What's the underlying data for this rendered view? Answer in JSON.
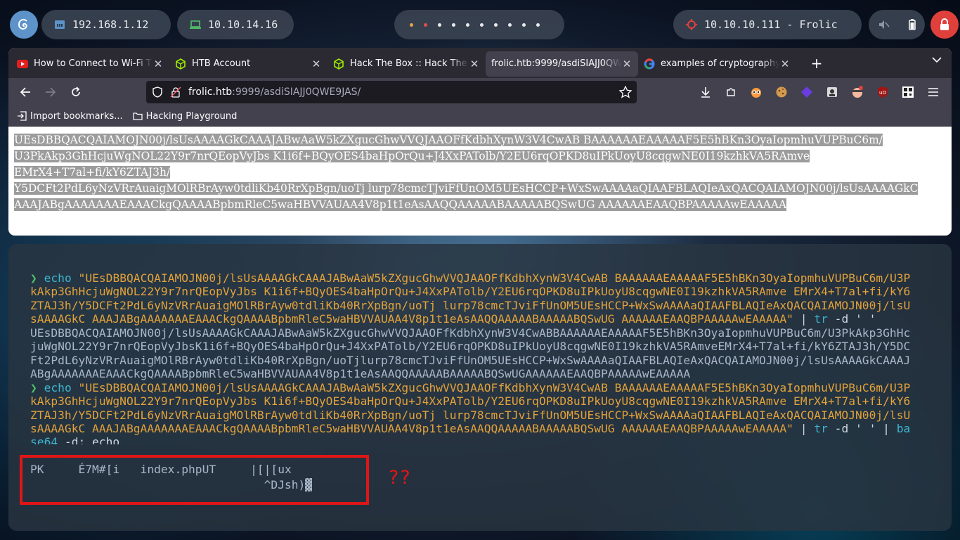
{
  "panel": {
    "local_ip": "192.168.1.12",
    "vpn_ip": "10.10.14.16",
    "target_label": "10.10.10.111 - Frolic",
    "workspace_count": 11,
    "active_workspace": 0
  },
  "browser": {
    "tabs": [
      {
        "title": "How to Connect to Wi-Fi Th",
        "favicon": "youtube-icon",
        "active": false
      },
      {
        "title": "HTB Account",
        "favicon": "htb-cube-icon",
        "active": false
      },
      {
        "title": "Hack The Box :: Hack The B",
        "favicon": "htb-cube-icon",
        "active": false
      },
      {
        "title": "frolic.htb:9999/asdiSIAJJ0QWE",
        "favicon": "none",
        "active": true
      },
      {
        "title": "examples of cryptography",
        "favicon": "google-icon",
        "active": false
      }
    ],
    "url_host": "frolic.htb",
    "url_rest": ":9999/asdiSIAJJ0QWE9JAS/",
    "bookmarks": [
      {
        "label": "Import bookmarks...",
        "icon": "import-icon"
      },
      {
        "label": "Hacking Playground",
        "icon": "folder-icon"
      }
    ],
    "page_lines": [
      "UEsDBBQACQAIAMOJN00j/lsUsAAAAGkCAAAJABwAaW5kZXgucGhwVVQJAAOFfKdbhXynW3V4CwAB BAAAAAAEAAAAAF5E5hBKn3OyaIopmhuVUPBuC6m/",
      "U3PkAkp3GhHcjuWgNOL22Y9r7nrQEopVyJbs K1i6f+BQyOES4baHpOrQu+J4XxPATolb/Y2EU6rqOPKD8uIPkUoyU8cqgwNE0I19kzhkVA5RAmve EMrX4+T7al+fi/kY6ZTAJ3h/",
      "Y5DCFt2PdL6yNzVRrAuaigMOlRBrAyw0tdliKb40RrXpBgn/uoTj lurp78cmcTJviFfUnOM5UEsHCCP+WxSwAAAAaQIAAFBLAQIeAxQACQAIAMOJN00j/lsUsAAAAGkC",
      "AAAJABgAAAAAAAEAAACkgQAAAABpbmRleC5waHBVVAUAA4V8p1t1eAsAAQQAAAAABAAAAABQSwUG AAAAAAEAAQBPAAAAAwEAAAAA"
    ]
  },
  "terminal": {
    "prompt": "❯",
    "command1": {
      "cmd": "echo",
      "lines": [
        "\"UEsDBBQACQAIAMOJN00j/lsUsAAAAGkCAAAJABwAaW5kZXgucGhwVVQJAAOFfKdbhXynW3V4CwAB BAAAAAAEAAAAAF5E5hBKn3OyaIopmhuVUPBuC6m/U3P",
        "kAkp3GhHcjuWgNOL22Y9r7nrQEopVyJbs K1i6f+BQyOES4baHpOrQu+J4XxPATolb/Y2EU6rqOPKD8uIPkUoyU8cqgwNE0I19kzhkVA5RAmve EMrX4+T7al+fi/kY6",
        "ZTAJ3h/Y5DCFt2PdL6yNzVRrAuaigMOlRBrAyw0tdliKb40RrXpBgn/uoTj lurp78cmcTJviFfUnOM5UEsHCCP+WxSwAAAAaQIAAFBLAQIeAxQACQAIAMOJN00j/lsU",
        "sAAAAGkC AAAJABgAAAAAAAEAAACkgQAAAABpbmRleC5waHBVVAUAA4V8p1t1eAsAAQQAAAAABAAAAABQSwUG AAAAAAEAAQBPAAAAAwEAAAAA\""
      ],
      "pipe": " | ",
      "tr_cmd": "tr",
      "tr_args": " -d ' '"
    },
    "output1": [
      "UEsDBBQACQAIAMOJN00j/lsUsAAAAGkCAAAJABwAaW5kZXgucGhwVVQJAAOFfKdbhXynW3V4CwABBAAAAAAEAAAAAF5E5hBKn3OyaIopmhuVUPBuC6m/U3PkAkp3GhHc",
      "juWgNOL22Y9r7nrQEopVyJbsK1i6f+BQyOES4baHpOrQu+J4XxPATolb/Y2EU6rqOPKD8uIPkUoyU8cqgwNE0I19kzhkVA5RAmveEMrX4+T7al+fi/kY6ZTAJ3h/Y5DC",
      "Ft2PdL6yNzVRrAuaigMOlRBrAyw0tdliKb40RrXpBgn/uoTjlurp78cmcTJviFfUnOM5UEsHCCP+WxSwAAAAaQIAAFBLAQIeAxQACQAIAMOJN00j/lsUsAAAAGkCAAAJ",
      "ABgAAAAAAAEAAACkgQAAAABpbmRleC5waHBVVAUAA4V8p1t1eAsAAQQAAAAABAAAAABQSwUGAAAAAAEAAQBPAAAAAwEAAAAA"
    ],
    "command2": {
      "cmd": "echo",
      "lines": [
        "\"UEsDBBQACQAIAMOJN00j/lsUsAAAAGkCAAAJABwAaW5kZXgucGhwVVQJAAOFfKdbhXynW3V4CwAB BAAAAAAEAAAAAF5E5hBKn3OyaIopmhuVUPBuC6m/U3P",
        "kAkp3GhHcjuWgNOL22Y9r7nrQEopVyJbs K1i6f+BQyOES4baHpOrQu+J4XxPATolb/Y2EU6rqOPKD8uIPkUoyU8cqgwNE0I19kzhkVA5RAmve EMrX4+T7al+fi/kY6",
        "ZTAJ3h/Y5DCFt2PdL6yNzVRrAuaigMOlRBrAyw0tdliKb40RrXpBgn/uoTj lurp78cmcTJviFfUnOM5UEsHCCP+WxSwAAAAaQIAAFBLAQIeAxQACQAIAMOJN00j/lsU",
        "sAAAAGkC AAAJABgAAAAAAAEAAACkgQAAAABpbmRleC5waHBVVAUAA4V8p1t1eAsAAQQAAAAABAAAAABQSwUG AAAAAAEAAQBPAAAAAwEAAAAA\""
      ],
      "pipe": " | ",
      "tr_cmd": "tr",
      "tr_args": " -d ' ' | ",
      "b64_cmd_a": "ba",
      "b64_cmd_b": "se64",
      "b64_args": " -d; echo"
    },
    "output2": [
      "PK     É7M#[i   index.phpUT     |[|[ux",
      "                                  ^DJsh)"
    ],
    "cursor_char": "░",
    "annotation": "??"
  },
  "colors": {
    "prompt": "#4fc06a",
    "command": "#3db6d0",
    "string": "#e2a23b",
    "highlight_box": "#e01616"
  }
}
